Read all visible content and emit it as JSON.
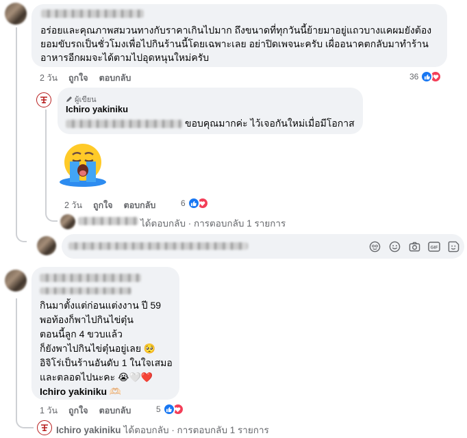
{
  "comment1": {
    "lines": [
      "อร่อยและคุณภาพสมวนทางกับราคาเกินไปมาก ถึงขนาดที่ทุกวันนี้ย้ายมาอยู่แถวบางแคผมยังต้อง",
      "ยอมขับรถเป็นชั่วโมงเพื่อไปกินร้านนี้โดยเฉพาะเลย อย่าปิดเพจนะครับ เผื่ออนาคตกลับมาทำร้าน",
      "อาหารอีกผมจะได้ตามไปอุดหนุนใหม่ครับ"
    ],
    "time": "2 วัน",
    "like": "ถูกใจ",
    "reply": "ตอบกลับ",
    "reaction_count": "36"
  },
  "author_reply": {
    "badge": "ผู้เขียน",
    "name": "Ichiro yakiniku",
    "text": "ขอบคุณมากค่ะ ไว้เจอกันใหม่เมื่อมีโอกาส",
    "time": "2 วัน",
    "like": "ถูกใจ",
    "reply": "ตอบกลับ",
    "reaction_count": "6",
    "emoji": "crying-face"
  },
  "nested_reply_summary": "ได้ตอบกลับ · การตอบกลับ 1 รายการ",
  "comment_input": {
    "icons": [
      "avatar-sticker-icon",
      "smile-icon",
      "camera-icon",
      "gif-icon",
      "sticker-icon"
    ],
    "gif_label": "GIF"
  },
  "comment2": {
    "lines": [
      "กินมาตั้งแต่ก่อนแต่งงาน ปี 59",
      "พอท้องก็พาไปกินไข่ตุ๋น",
      "ตอนนี้ลูก 4 ขวบแล้ว",
      "ก็ยังพาไปกินไข่ตุ๋นอยู่เลย 🥺",
      "อิจิโร่เป็นร้านอันดับ 1 ในใจเสมอ",
      "และตลอดไปนะคะ 😭🤍❤️",
      "Ichiro yakiniku 🫶🏻"
    ],
    "time": "1 วัน",
    "like": "ถูกใจ",
    "reply": "ตอบกลับ",
    "reaction_count": "5"
  },
  "comment2_reply_summary": {
    "name": "Ichiro yakiniku",
    "text": "ได้ตอบกลับ · การตอบกลับ 1 รายการ"
  },
  "colors": {
    "bubble": "#f0f2f5",
    "meta": "#65676b",
    "like_blue": "#1877f2",
    "love_red": "#f33e58",
    "thread": "#ced0d4"
  }
}
